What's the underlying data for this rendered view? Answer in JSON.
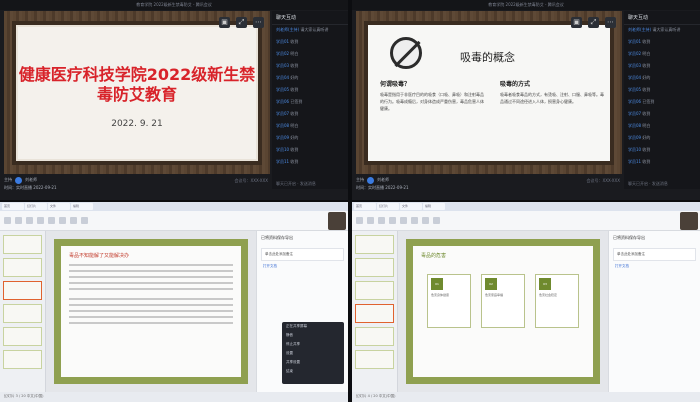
{
  "window_title": "教育学院 2022级新生禁毒防艾 - 腾讯会议",
  "q1": {
    "slide_title": "健康医疗科技学院2022级新生禁毒防艾教育",
    "slide_date": "2022. 9. 21",
    "info_host_label": "主持",
    "info_host_name": "刘老师",
    "info_time": "时间：实时直播 2022-09-21",
    "info_right": "会议号：XXX-XXX"
  },
  "q2": {
    "slide_title": "吸毒的概念",
    "col1_title": "何谓吸毒？",
    "col1_text": "吸毒是指用于非医疗目的的吸食（口吸、鼻吸）和注射毒品的行为。吸毒成瘾后，对身体造成严重伤害，毒品危害人体健康。",
    "col2_title": "吸毒的方式",
    "col2_text": "吸毒者吸食毒品的方式，有烫吸、注射、口服、鼻吸等。毒品通过不同途径进入人体，损害身心健康。"
  },
  "chat": {
    "header": "聊天互动",
    "rows": [
      {
        "name": "刘老师(主持)",
        "msg": "请大家认真听讲"
      },
      {
        "name": "学员01",
        "msg": "收到"
      },
      {
        "name": "学员02",
        "msg": "明白"
      },
      {
        "name": "学员03",
        "msg": "收到"
      },
      {
        "name": "学员04",
        "msg": "好的"
      },
      {
        "name": "学员05",
        "msg": "收到"
      },
      {
        "name": "学员06",
        "msg": "已签到"
      },
      {
        "name": "学员07",
        "msg": "收到"
      },
      {
        "name": "学员08",
        "msg": "明白"
      },
      {
        "name": "学员09",
        "msg": "好的"
      },
      {
        "name": "学员10",
        "msg": "收到"
      },
      {
        "name": "学员11",
        "msg": "收到"
      }
    ],
    "footer": "聊天已开启 · 发送消息"
  },
  "q3": {
    "slide_title": "毒品不知能解了又能解决办",
    "panel_title": "已将资料保存导出",
    "panel_card": "单击此处添加备注",
    "panel_link": "打开文档",
    "status": "幻灯片 3 / 20  中文(中国)",
    "popup_rows": [
      "正在共享屏幕",
      "静音",
      "停止共享",
      "设置",
      "共享设置",
      "结束"
    ]
  },
  "q4": {
    "slide_title": "毒品的危害",
    "boxes": [
      {
        "head": "01",
        "text": "危害身体健康"
      },
      {
        "head": "02",
        "text": "危害家庭幸福"
      },
      {
        "head": "03",
        "text": "危害社会稳定"
      }
    ],
    "panel_title": "已将资料保存导出",
    "panel_card": "单击此处添加备注",
    "panel_link": "打开文档",
    "status": "幻灯片 4 / 20  中文(中国)"
  },
  "tabs": [
    "首页",
    "幻灯片",
    "文件",
    "编辑"
  ]
}
